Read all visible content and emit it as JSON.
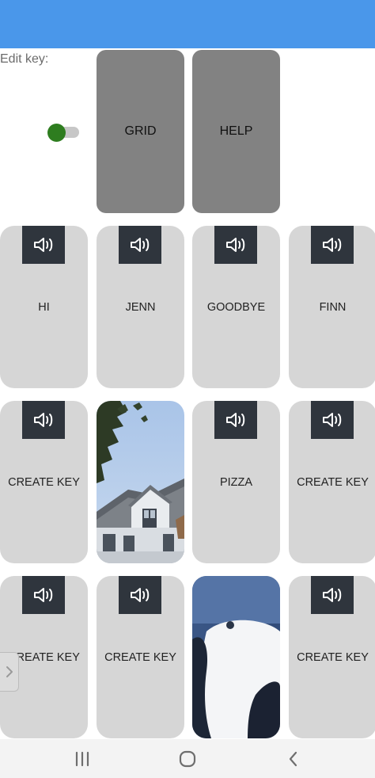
{
  "edit_key": {
    "label": "Edit key:",
    "enabled": true,
    "toggle_color": "#2e7d1f"
  },
  "header": {
    "color": "#4a97ea"
  },
  "menu": {
    "grid_label": "GRID",
    "help_label": "HELP"
  },
  "keys": [
    {
      "label": "HI",
      "icon": "speaker-icon"
    },
    {
      "label": "JENN",
      "icon": "speaker-icon"
    },
    {
      "label": "GOODBYE",
      "icon": "speaker-icon"
    },
    {
      "label": "FINN",
      "icon": "speaker-icon"
    },
    {
      "label": "CREATE KEY",
      "icon": "speaker-icon"
    },
    {
      "label": "",
      "image": "house-photo"
    },
    {
      "label": "PIZZA",
      "icon": "speaker-icon"
    },
    {
      "label": "CREATE KEY",
      "icon": "speaker-icon"
    },
    {
      "label": "CREATE KEY",
      "icon": "speaker-icon"
    },
    {
      "label": "CREATE KEY",
      "icon": "speaker-icon"
    },
    {
      "label": "",
      "image": "person-photo"
    },
    {
      "label": "CREATE KEY",
      "icon": "speaker-icon"
    }
  ],
  "nav": {
    "icons": [
      "recent-apps-icon",
      "home-icon",
      "back-icon"
    ]
  }
}
